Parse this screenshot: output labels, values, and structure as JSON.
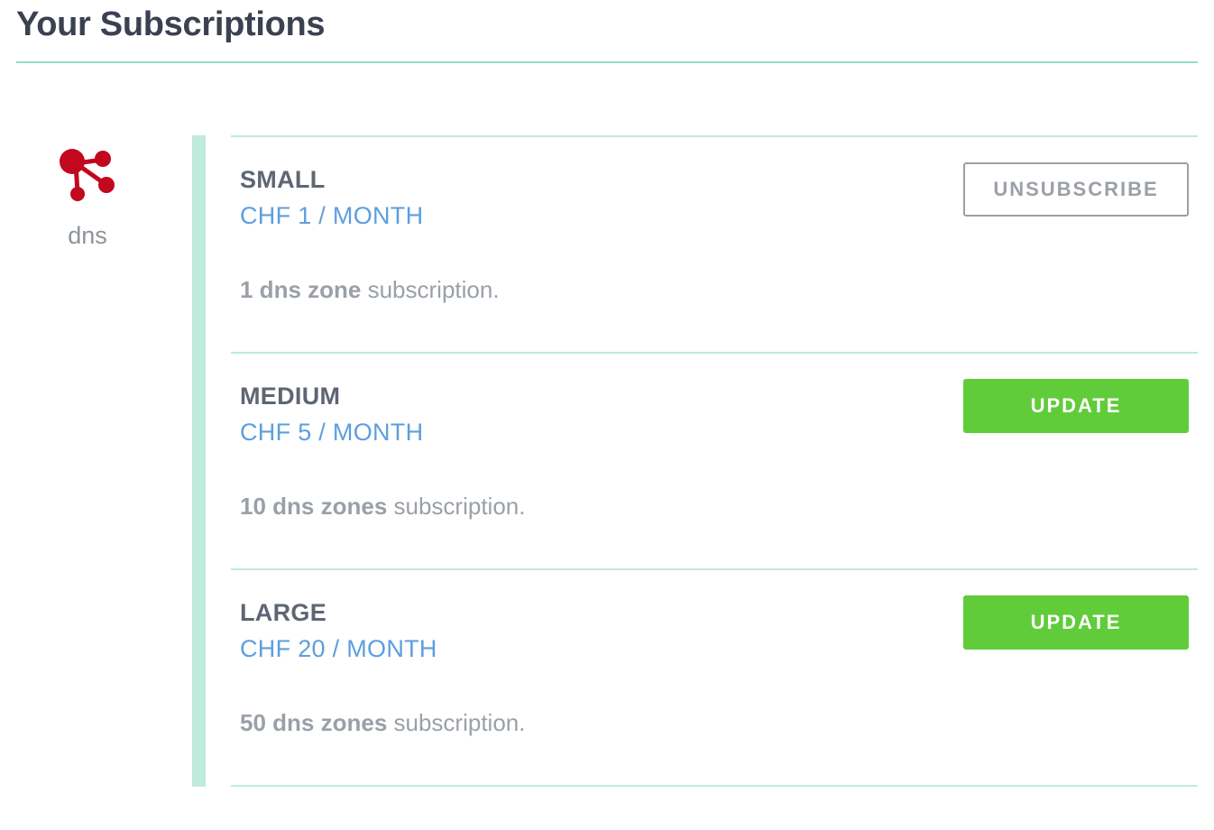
{
  "header": {
    "title": "Your Subscriptions"
  },
  "service": {
    "name": "dns",
    "icon": "share-network-icon",
    "icon_color": "#c2081d"
  },
  "plans": [
    {
      "name": "SMALL",
      "price": "CHF 1 / MONTH",
      "desc_bold": "1 dns zone",
      "desc_rest": " subscription.",
      "action_label": "UNSUBSCRIBE",
      "action_style": "outline"
    },
    {
      "name": "MEDIUM",
      "price": "CHF 5 / MONTH",
      "desc_bold": "10 dns zones",
      "desc_rest": " subscription.",
      "action_label": "UPDATE",
      "action_style": "primary"
    },
    {
      "name": "LARGE",
      "price": "CHF 20 / MONTH",
      "desc_bold": "50 dns zones",
      "desc_rest": " subscription.",
      "action_label": "UPDATE",
      "action_style": "primary"
    }
  ],
  "colors": {
    "accent": "#8fe0c8",
    "price": "#5d9ede",
    "primary_button": "#60cc3a",
    "title": "#3a4150"
  }
}
